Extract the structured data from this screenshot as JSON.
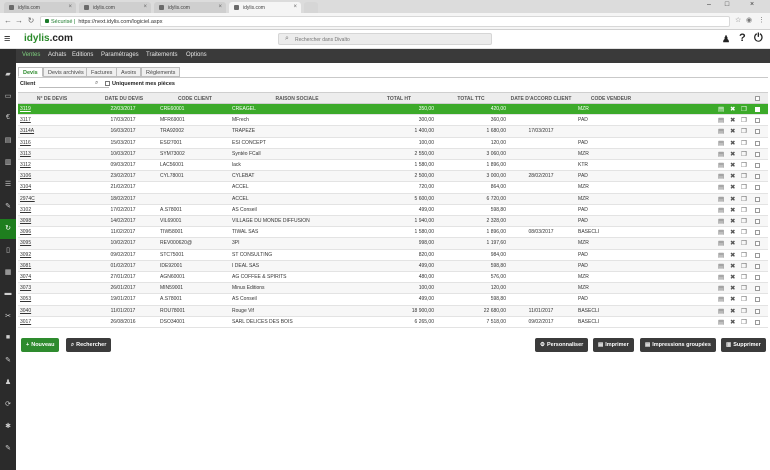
{
  "browser": {
    "tabs": [
      {
        "label": "idylis.com",
        "active": false
      },
      {
        "label": "idylis.com",
        "active": false
      },
      {
        "label": "idylis.com",
        "active": false
      },
      {
        "label": "idylis.com",
        "active": true
      }
    ],
    "security_label": "Sécurisé",
    "url": "https://next.idylis.com/logiciel.aspx"
  },
  "header": {
    "logo": "idylis",
    "logo_suffix": ".com",
    "search_placeholder": "Rechercher dans Divalto",
    "help": "?"
  },
  "main_menu": [
    {
      "label": "Ventes",
      "active": true
    },
    {
      "label": "Achats",
      "active": false
    },
    {
      "label": "Editions",
      "active": false
    },
    {
      "label": "Paramétrages",
      "active": false
    },
    {
      "label": "Traitements",
      "active": false
    },
    {
      "label": "Options",
      "active": false
    }
  ],
  "sub_tabs": [
    {
      "label": "Devis",
      "active": true
    },
    {
      "label": "Devis archivés",
      "active": false
    },
    {
      "label": "Factures",
      "active": false
    },
    {
      "label": "Avoirs",
      "active": false
    },
    {
      "label": "Règlements",
      "active": false
    }
  ],
  "filters": {
    "client_label": "Client",
    "only_mine_label": "Uniquement mes pièces"
  },
  "table": {
    "columns": [
      "N° DE DEVIS",
      "DATE DU DEVIS",
      "CODE CLIENT",
      "RAISON SOCIALE",
      "TOTAL HT",
      "TOTAL TTC",
      "DATE D'ACCORD CLIENT",
      "CODE VENDEUR"
    ],
    "rows": [
      {
        "num": "3119",
        "date": "22/03/2017",
        "code": "CRE60001",
        "raison": "CREAGEL",
        "ht": "350,00",
        "ttc": "420,00",
        "accord": "",
        "vendeur": "MZR",
        "selected": true
      },
      {
        "num": "3117",
        "date": "17/03/2017",
        "code": "MFR69001",
        "raison": "MFrech",
        "ht": "300,00",
        "ttc": "360,00",
        "accord": "",
        "vendeur": "PAD"
      },
      {
        "num": "3114A",
        "date": "16/03/2017",
        "code": "TRA92002",
        "raison": "TRAPEZE",
        "ht": "1 400,00",
        "ttc": "1 680,00",
        "accord": "17/03/2017",
        "vendeur": ""
      },
      {
        "num": "3116",
        "date": "15/03/2017",
        "code": "ESI27001",
        "raison": "ESI CONCEPT",
        "ht": "100,00",
        "ttc": "120,00",
        "accord": "",
        "vendeur": "PAD"
      },
      {
        "num": "3113",
        "date": "10/03/2017",
        "code": "SYM73002",
        "raison": "Syntéo FCall",
        "ht": "2 550,00",
        "ttc": "3 060,00",
        "accord": "",
        "vendeur": "MZR"
      },
      {
        "num": "3112",
        "date": "09/03/2017",
        "code": "LAC56001",
        "raison": "lack",
        "ht": "1 580,00",
        "ttc": "1 896,00",
        "accord": "",
        "vendeur": "KTR"
      },
      {
        "num": "3106",
        "date": "23/02/2017",
        "code": "CYL78001",
        "raison": "CYLEBAT",
        "ht": "2 500,00",
        "ttc": "3 000,00",
        "accord": "28/02/2017",
        "vendeur": "PAD"
      },
      {
        "num": "3104",
        "date": "21/02/2017",
        "code": "",
        "raison": "ACCEL",
        "ht": "720,00",
        "ttc": "864,00",
        "accord": "",
        "vendeur": "MZR"
      },
      {
        "num": "2974C",
        "date": "18/02/2017",
        "code": "",
        "raison": "ACCEL",
        "ht": "5 600,00",
        "ttc": "6 720,00",
        "accord": "",
        "vendeur": "MZR"
      },
      {
        "num": "3102",
        "date": "17/02/2017",
        "code": "A.S78001",
        "raison": "AS Conseil",
        "ht": "499,00",
        "ttc": "598,80",
        "accord": "",
        "vendeur": "PAD"
      },
      {
        "num": "3098",
        "date": "14/02/2017",
        "code": "VIL69001",
        "raison": "VILLAGE DU MONDE DIFFUSION",
        "ht": "1 940,00",
        "ttc": "2 328,00",
        "accord": "",
        "vendeur": "PAD"
      },
      {
        "num": "3096",
        "date": "11/02/2017",
        "code": "TIW58001",
        "raison": "TIWAL SAS",
        "ht": "1 580,00",
        "ttc": "1 896,00",
        "accord": "08/03/2017",
        "vendeur": "BASECLI"
      },
      {
        "num": "3095",
        "date": "10/02/2017",
        "code": "REV000620@",
        "raison": "3PI",
        "ht": "998,00",
        "ttc": "1 197,60",
        "accord": "",
        "vendeur": "MZR"
      },
      {
        "num": "3092",
        "date": "09/02/2017",
        "code": "STC75001",
        "raison": "ST CONSULTING",
        "ht": "820,00",
        "ttc": "984,00",
        "accord": "",
        "vendeur": "PAD"
      },
      {
        "num": "3081",
        "date": "01/02/2017",
        "code": "IDE92001",
        "raison": "I DEAL SAS",
        "ht": "499,00",
        "ttc": "598,80",
        "accord": "",
        "vendeur": "PAD"
      },
      {
        "num": "3074",
        "date": "27/01/2017",
        "code": "AGN60001",
        "raison": "AG COFFEE & SPIRITS",
        "ht": "480,00",
        "ttc": "576,00",
        "accord": "",
        "vendeur": "MZR"
      },
      {
        "num": "3073",
        "date": "26/01/2017",
        "code": "MIN59001",
        "raison": "Minus Editions",
        "ht": "100,00",
        "ttc": "120,00",
        "accord": "",
        "vendeur": "MZR"
      },
      {
        "num": "3053",
        "date": "19/01/2017",
        "code": "A.S78001",
        "raison": "AS Conseil",
        "ht": "499,00",
        "ttc": "598,80",
        "accord": "",
        "vendeur": "PAD"
      },
      {
        "num": "3040",
        "date": "11/01/2017",
        "code": "ROU78001",
        "raison": "Rouge Vif",
        "ht": "18 900,00",
        "ttc": "22 680,00",
        "accord": "11/01/2017",
        "vendeur": "BASECLI"
      },
      {
        "num": "3017",
        "date": "26/08/2016",
        "code": "DSO34001",
        "raison": "SARL DELICES DES BOIS",
        "ht": "6 265,00",
        "ttc": "7 518,00",
        "accord": "09/02/2017",
        "vendeur": "BASECLI"
      }
    ]
  },
  "buttons": {
    "nouveau": "Nouveau",
    "rechercher": "Rechercher",
    "personnaliser": "Personnaliser",
    "imprimer": "Imprimer",
    "impressions_groupees": "Impressions groupées",
    "supprimer": "Supprimer"
  },
  "colors": {
    "accent": "#3caa2a",
    "menu_bg": "#3a3a3a",
    "rail_bg": "#2b2b2b"
  }
}
